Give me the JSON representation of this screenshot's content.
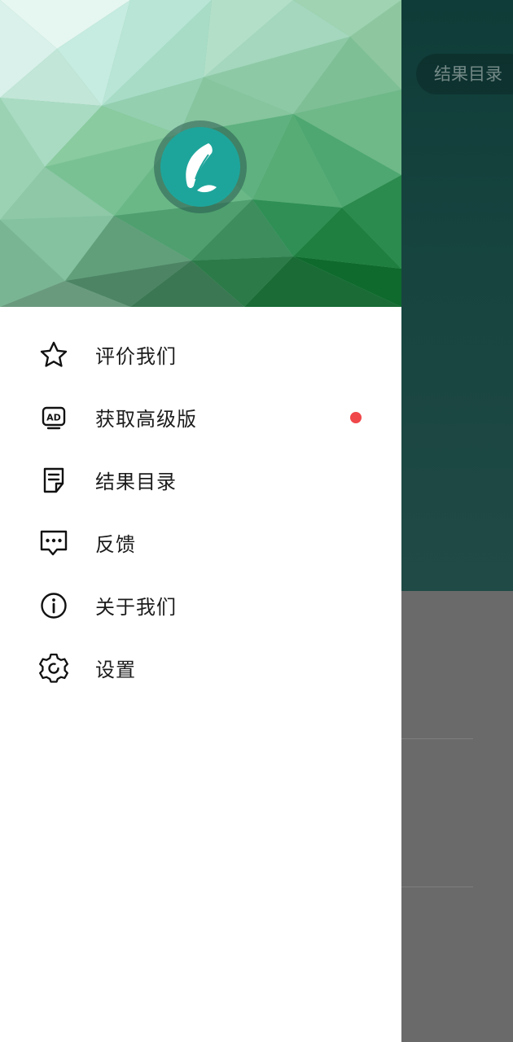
{
  "background_app": {
    "results_button_label": "结果目录"
  },
  "drawer": {
    "menu": [
      {
        "key": "rate",
        "label": "评价我们",
        "icon": "star-icon"
      },
      {
        "key": "premium",
        "label": "获取高级版",
        "icon": "ad-icon",
        "badge": "red-dot"
      },
      {
        "key": "results",
        "label": "结果目录",
        "icon": "note-icon"
      },
      {
        "key": "feedback",
        "label": "反馈",
        "icon": "chat-bubble-icon"
      },
      {
        "key": "about",
        "label": "关于我们",
        "icon": "info-icon"
      },
      {
        "key": "settings",
        "label": "设置",
        "icon": "gear-icon"
      }
    ]
  },
  "colors": {
    "header_dark": "#0f3c38",
    "avatar_teal": "#1ea59b",
    "badge_red": "#f0474a",
    "overlay_gray": "#6a6a6a"
  }
}
